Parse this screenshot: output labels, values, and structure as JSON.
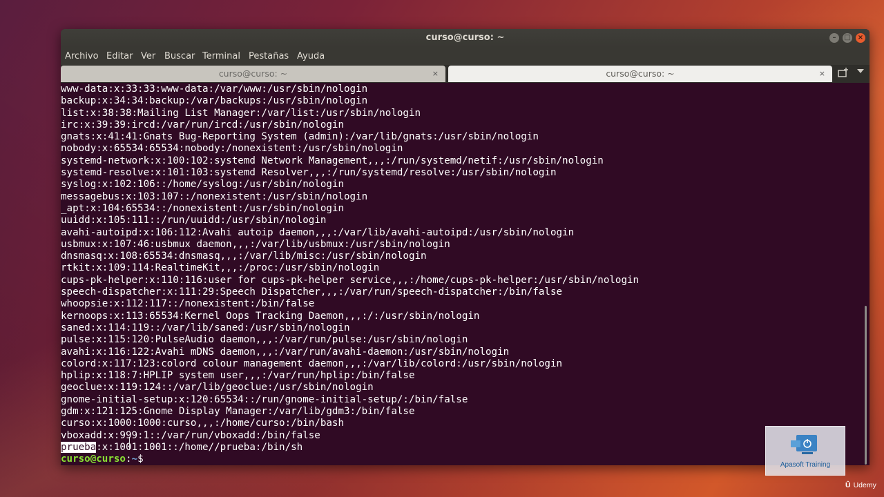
{
  "window": {
    "title": "curso@curso: ~",
    "controls": {
      "minimize": "–",
      "maximize": "□",
      "close": "×"
    }
  },
  "menubar": {
    "items": [
      "Archivo",
      "Editar",
      "Ver",
      "Buscar",
      "Terminal",
      "Pestañas",
      "Ayuda"
    ]
  },
  "tabs": [
    {
      "label": "curso@curso: ~",
      "close": "×",
      "active": false
    },
    {
      "label": "curso@curso: ~",
      "close": "×",
      "active": true
    }
  ],
  "terminal": {
    "lines": [
      "www-data:x:33:33:www-data:/var/www:/usr/sbin/nologin",
      "backup:x:34:34:backup:/var/backups:/usr/sbin/nologin",
      "list:x:38:38:Mailing List Manager:/var/list:/usr/sbin/nologin",
      "irc:x:39:39:ircd:/var/run/ircd:/usr/sbin/nologin",
      "gnats:x:41:41:Gnats Bug-Reporting System (admin):/var/lib/gnats:/usr/sbin/nologin",
      "nobody:x:65534:65534:nobody:/nonexistent:/usr/sbin/nologin",
      "systemd-network:x:100:102:systemd Network Management,,,:/run/systemd/netif:/usr/sbin/nologin",
      "systemd-resolve:x:101:103:systemd Resolver,,,:/run/systemd/resolve:/usr/sbin/nologin",
      "syslog:x:102:106::/home/syslog:/usr/sbin/nologin",
      "messagebus:x:103:107::/nonexistent:/usr/sbin/nologin",
      "_apt:x:104:65534::/nonexistent:/usr/sbin/nologin",
      "uuidd:x:105:111::/run/uuidd:/usr/sbin/nologin",
      "avahi-autoipd:x:106:112:Avahi autoip daemon,,,:/var/lib/avahi-autoipd:/usr/sbin/nologin",
      "usbmux:x:107:46:usbmux daemon,,,:/var/lib/usbmux:/usr/sbin/nologin",
      "dnsmasq:x:108:65534:dnsmasq,,,:/var/lib/misc:/usr/sbin/nologin",
      "rtkit:x:109:114:RealtimeKit,,,:/proc:/usr/sbin/nologin",
      "cups-pk-helper:x:110:116:user for cups-pk-helper service,,,:/home/cups-pk-helper:/usr/sbin/nologin",
      "speech-dispatcher:x:111:29:Speech Dispatcher,,,:/var/run/speech-dispatcher:/bin/false",
      "whoopsie:x:112:117::/nonexistent:/bin/false",
      "kernoops:x:113:65534:Kernel Oops Tracking Daemon,,,:/:/usr/sbin/nologin",
      "saned:x:114:119::/var/lib/saned:/usr/sbin/nologin",
      "pulse:x:115:120:PulseAudio daemon,,,:/var/run/pulse:/usr/sbin/nologin",
      "avahi:x:116:122:Avahi mDNS daemon,,,:/var/run/avahi-daemon:/usr/sbin/nologin",
      "colord:x:117:123:colord colour management daemon,,,:/var/lib/colord:/usr/sbin/nologin",
      "hplip:x:118:7:HPLIP system user,,,:/var/run/hplip:/bin/false",
      "geoclue:x:119:124::/var/lib/geoclue:/usr/sbin/nologin",
      "gnome-initial-setup:x:120:65534::/run/gnome-initial-setup/:/bin/false",
      "gdm:x:121:125:Gnome Display Manager:/var/lib/gdm3:/bin/false",
      "curso:x:1000:1000:curso,,,:/home/curso:/bin/bash",
      "vboxadd:x:999:1::/var/run/vboxadd:/bin/false"
    ],
    "highlighted_line": {
      "selected": "prueba",
      "rest": ":x:1001:1001::/home//prueba:/bin/sh"
    },
    "prompt": {
      "user": "curso@curso",
      "sep": ":",
      "path": "~",
      "symbol": "$"
    }
  },
  "watermark": {
    "text": "Apasoft Training"
  },
  "udemy": {
    "text": "Udemy"
  },
  "colors": {
    "terminal_bg": "#300a24",
    "prompt_user": "#8ae234",
    "prompt_path": "#729fcf",
    "close_button": "#e85c2e"
  }
}
